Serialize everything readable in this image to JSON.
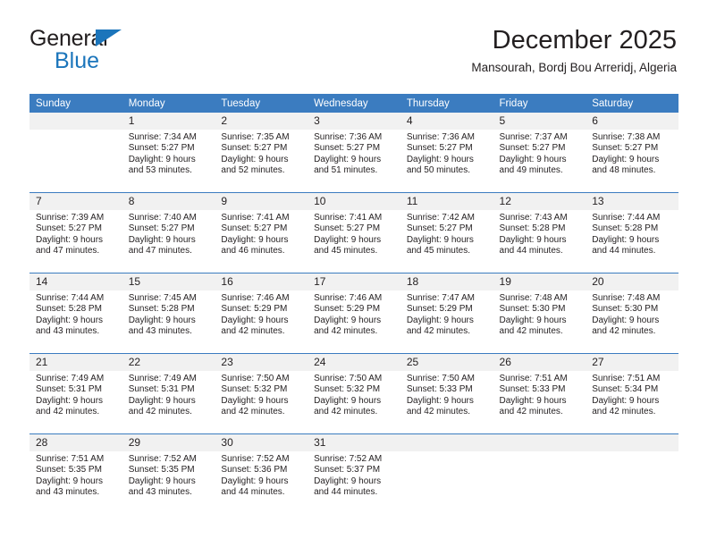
{
  "brand": {
    "name_top": "General",
    "name_bottom": "Blue",
    "accent_color": "#1b75bb",
    "triangle_icon": "triangle-icon"
  },
  "header": {
    "title": "December 2025",
    "subtitle": "Mansourah, Bordj Bou Arreridj, Algeria"
  },
  "theme": {
    "header_row_bg": "#3b7cc0",
    "header_row_text": "#ffffff",
    "daynum_bg": "#f1f1f1",
    "grid_line": "#3b7cc0",
    "body_text": "#231f20",
    "page_bg": "#ffffff"
  },
  "weekday_headers": [
    "Sunday",
    "Monday",
    "Tuesday",
    "Wednesday",
    "Thursday",
    "Friday",
    "Saturday"
  ],
  "weeks": [
    [
      {
        "day": "",
        "sunrise": "",
        "sunset": "",
        "daylight": "",
        "blank": true
      },
      {
        "day": "1",
        "sunrise": "Sunrise: 7:34 AM",
        "sunset": "Sunset: 5:27 PM",
        "daylight": "Daylight: 9 hours and 53 minutes."
      },
      {
        "day": "2",
        "sunrise": "Sunrise: 7:35 AM",
        "sunset": "Sunset: 5:27 PM",
        "daylight": "Daylight: 9 hours and 52 minutes."
      },
      {
        "day": "3",
        "sunrise": "Sunrise: 7:36 AM",
        "sunset": "Sunset: 5:27 PM",
        "daylight": "Daylight: 9 hours and 51 minutes."
      },
      {
        "day": "4",
        "sunrise": "Sunrise: 7:36 AM",
        "sunset": "Sunset: 5:27 PM",
        "daylight": "Daylight: 9 hours and 50 minutes."
      },
      {
        "day": "5",
        "sunrise": "Sunrise: 7:37 AM",
        "sunset": "Sunset: 5:27 PM",
        "daylight": "Daylight: 9 hours and 49 minutes."
      },
      {
        "day": "6",
        "sunrise": "Sunrise: 7:38 AM",
        "sunset": "Sunset: 5:27 PM",
        "daylight": "Daylight: 9 hours and 48 minutes."
      }
    ],
    [
      {
        "day": "7",
        "sunrise": "Sunrise: 7:39 AM",
        "sunset": "Sunset: 5:27 PM",
        "daylight": "Daylight: 9 hours and 47 minutes."
      },
      {
        "day": "8",
        "sunrise": "Sunrise: 7:40 AM",
        "sunset": "Sunset: 5:27 PM",
        "daylight": "Daylight: 9 hours and 47 minutes."
      },
      {
        "day": "9",
        "sunrise": "Sunrise: 7:41 AM",
        "sunset": "Sunset: 5:27 PM",
        "daylight": "Daylight: 9 hours and 46 minutes."
      },
      {
        "day": "10",
        "sunrise": "Sunrise: 7:41 AM",
        "sunset": "Sunset: 5:27 PM",
        "daylight": "Daylight: 9 hours and 45 minutes."
      },
      {
        "day": "11",
        "sunrise": "Sunrise: 7:42 AM",
        "sunset": "Sunset: 5:27 PM",
        "daylight": "Daylight: 9 hours and 45 minutes."
      },
      {
        "day": "12",
        "sunrise": "Sunrise: 7:43 AM",
        "sunset": "Sunset: 5:28 PM",
        "daylight": "Daylight: 9 hours and 44 minutes."
      },
      {
        "day": "13",
        "sunrise": "Sunrise: 7:44 AM",
        "sunset": "Sunset: 5:28 PM",
        "daylight": "Daylight: 9 hours and 44 minutes."
      }
    ],
    [
      {
        "day": "14",
        "sunrise": "Sunrise: 7:44 AM",
        "sunset": "Sunset: 5:28 PM",
        "daylight": "Daylight: 9 hours and 43 minutes."
      },
      {
        "day": "15",
        "sunrise": "Sunrise: 7:45 AM",
        "sunset": "Sunset: 5:28 PM",
        "daylight": "Daylight: 9 hours and 43 minutes."
      },
      {
        "day": "16",
        "sunrise": "Sunrise: 7:46 AM",
        "sunset": "Sunset: 5:29 PM",
        "daylight": "Daylight: 9 hours and 42 minutes."
      },
      {
        "day": "17",
        "sunrise": "Sunrise: 7:46 AM",
        "sunset": "Sunset: 5:29 PM",
        "daylight": "Daylight: 9 hours and 42 minutes."
      },
      {
        "day": "18",
        "sunrise": "Sunrise: 7:47 AM",
        "sunset": "Sunset: 5:29 PM",
        "daylight": "Daylight: 9 hours and 42 minutes."
      },
      {
        "day": "19",
        "sunrise": "Sunrise: 7:48 AM",
        "sunset": "Sunset: 5:30 PM",
        "daylight": "Daylight: 9 hours and 42 minutes."
      },
      {
        "day": "20",
        "sunrise": "Sunrise: 7:48 AM",
        "sunset": "Sunset: 5:30 PM",
        "daylight": "Daylight: 9 hours and 42 minutes."
      }
    ],
    [
      {
        "day": "21",
        "sunrise": "Sunrise: 7:49 AM",
        "sunset": "Sunset: 5:31 PM",
        "daylight": "Daylight: 9 hours and 42 minutes."
      },
      {
        "day": "22",
        "sunrise": "Sunrise: 7:49 AM",
        "sunset": "Sunset: 5:31 PM",
        "daylight": "Daylight: 9 hours and 42 minutes."
      },
      {
        "day": "23",
        "sunrise": "Sunrise: 7:50 AM",
        "sunset": "Sunset: 5:32 PM",
        "daylight": "Daylight: 9 hours and 42 minutes."
      },
      {
        "day": "24",
        "sunrise": "Sunrise: 7:50 AM",
        "sunset": "Sunset: 5:32 PM",
        "daylight": "Daylight: 9 hours and 42 minutes."
      },
      {
        "day": "25",
        "sunrise": "Sunrise: 7:50 AM",
        "sunset": "Sunset: 5:33 PM",
        "daylight": "Daylight: 9 hours and 42 minutes."
      },
      {
        "day": "26",
        "sunrise": "Sunrise: 7:51 AM",
        "sunset": "Sunset: 5:33 PM",
        "daylight": "Daylight: 9 hours and 42 minutes."
      },
      {
        "day": "27",
        "sunrise": "Sunrise: 7:51 AM",
        "sunset": "Sunset: 5:34 PM",
        "daylight": "Daylight: 9 hours and 42 minutes."
      }
    ],
    [
      {
        "day": "28",
        "sunrise": "Sunrise: 7:51 AM",
        "sunset": "Sunset: 5:35 PM",
        "daylight": "Daylight: 9 hours and 43 minutes."
      },
      {
        "day": "29",
        "sunrise": "Sunrise: 7:52 AM",
        "sunset": "Sunset: 5:35 PM",
        "daylight": "Daylight: 9 hours and 43 minutes."
      },
      {
        "day": "30",
        "sunrise": "Sunrise: 7:52 AM",
        "sunset": "Sunset: 5:36 PM",
        "daylight": "Daylight: 9 hours and 44 minutes."
      },
      {
        "day": "31",
        "sunrise": "Sunrise: 7:52 AM",
        "sunset": "Sunset: 5:37 PM",
        "daylight": "Daylight: 9 hours and 44 minutes."
      },
      {
        "day": "",
        "sunrise": "",
        "sunset": "",
        "daylight": "",
        "blank": true
      },
      {
        "day": "",
        "sunrise": "",
        "sunset": "",
        "daylight": "",
        "blank": true
      },
      {
        "day": "",
        "sunrise": "",
        "sunset": "",
        "daylight": "",
        "blank": true
      }
    ]
  ]
}
